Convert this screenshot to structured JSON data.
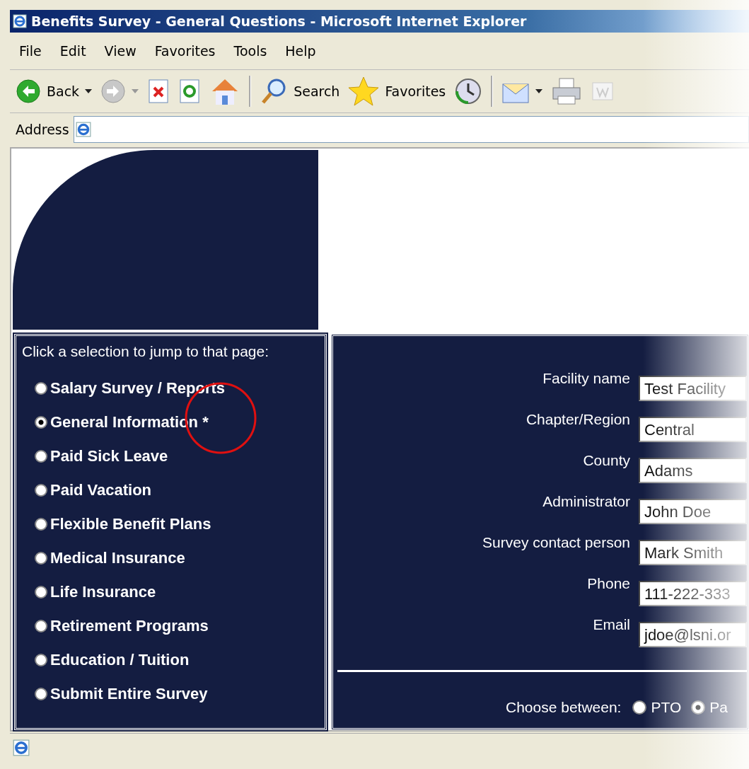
{
  "window": {
    "title": "Benefits Survey - General Questions - Microsoft Internet Explorer"
  },
  "menu": [
    "File",
    "Edit",
    "View",
    "Favorites",
    "Tools",
    "Help"
  ],
  "toolbar": {
    "back": "Back",
    "search": "Search",
    "favorites": "Favorites"
  },
  "address_bar": {
    "label": "Address"
  },
  "nav": {
    "prompt": "Click a selection to jump to that page:",
    "items": [
      {
        "label": "Salary Survey / Reports",
        "selected": false
      },
      {
        "label": "General Information *",
        "selected": true
      },
      {
        "label": "Paid Sick Leave",
        "selected": false
      },
      {
        "label": "Paid Vacation",
        "selected": false
      },
      {
        "label": "Flexible Benefit Plans",
        "selected": false
      },
      {
        "label": "Medical Insurance",
        "selected": false
      },
      {
        "label": "Life Insurance",
        "selected": false
      },
      {
        "label": "Retirement Programs",
        "selected": false
      },
      {
        "label": "Education / Tuition",
        "selected": false
      },
      {
        "label": "Submit Entire Survey",
        "selected": false
      }
    ]
  },
  "form": {
    "fields": [
      {
        "label": "Facility name",
        "value": "Test Facility"
      },
      {
        "label": "Chapter/Region",
        "value": "Central"
      },
      {
        "label": "County",
        "value": "Adams"
      },
      {
        "label": "Administrator",
        "value": "John Doe"
      },
      {
        "label": "Survey contact person",
        "value": "Mark Smith"
      },
      {
        "label": "Phone",
        "value": "111-222-333"
      },
      {
        "label": "Email",
        "value": "jdoe@lsni.or"
      }
    ],
    "choice": {
      "label": "Choose between:",
      "options": [
        {
          "label": "PTO",
          "selected": false
        },
        {
          "label": "Pa",
          "selected": true
        }
      ]
    }
  }
}
